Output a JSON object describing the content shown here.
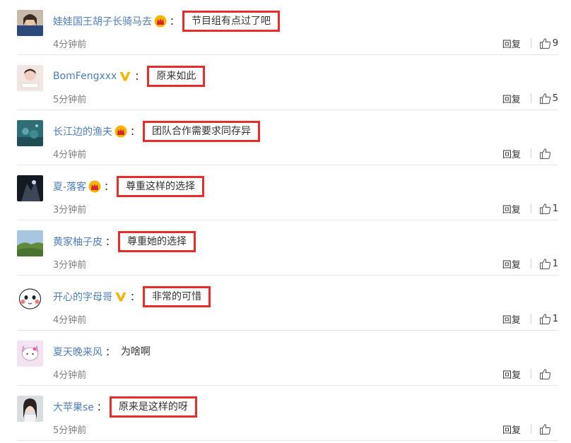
{
  "ui": {
    "reply_label": "回复",
    "colon": "：",
    "highlight_color": "#e82b2b",
    "username_color": "#4e7eb8"
  },
  "comments": [
    {
      "username": "娃娃国王胡子长骑马去",
      "badge": "crown-icon",
      "text": "节目组有点过了吧",
      "time": "4分钟前",
      "likes": "9",
      "highlighted": true
    },
    {
      "username": "BomFengxxx",
      "badge": "verified-v-icon",
      "text": "原来如此",
      "time": "5分钟前",
      "likes": "5",
      "highlighted": true
    },
    {
      "username": "长江边的渔夫",
      "badge": "crown-icon",
      "text": "团队合作需要求同存异",
      "time": "4分钟前",
      "likes": "",
      "highlighted": true
    },
    {
      "username": "夏-落客",
      "badge": "crown-icon",
      "text": "尊重这样的选择",
      "time": "3分钟前",
      "likes": "1",
      "highlighted": true
    },
    {
      "username": "黄家柚子皮",
      "badge": "",
      "text": "尊重她的选择",
      "time": "3分钟前",
      "likes": "1",
      "highlighted": true
    },
    {
      "username": "开心的字母哥",
      "badge": "verified-v-icon",
      "text": "非常的可惜",
      "time": "4分钟前",
      "likes": "1",
      "highlighted": true
    },
    {
      "username": "夏天晚来风",
      "badge": "",
      "text": "为啥啊",
      "time": "4分钟前",
      "likes": "",
      "highlighted": false
    },
    {
      "username": "大苹果se",
      "badge": "",
      "text": "原来是这样的呀",
      "time": "5分钟前",
      "likes": "",
      "highlighted": true
    }
  ]
}
